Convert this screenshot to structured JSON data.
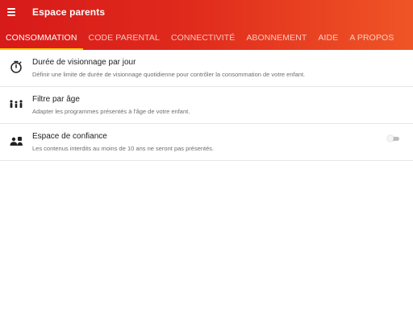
{
  "appbar": {
    "title": "Espace parents",
    "menu_icon": "hamburger-menu-icon",
    "gradient_start": "#d71a1a",
    "gradient_end": "#ef5526"
  },
  "tabs": [
    {
      "label": "CONSOMMATION",
      "active": true
    },
    {
      "label": "CODE PARENTAL",
      "active": false
    },
    {
      "label": "CONNECTIVITÉ",
      "active": false
    },
    {
      "label": "ABONNEMENT",
      "active": false
    },
    {
      "label": "AIDE",
      "active": false
    },
    {
      "label": "A PROPOS",
      "active": false
    }
  ],
  "tab_indicator_color": "#ffcc00",
  "settings": [
    {
      "icon": "timer-icon",
      "title": "Durée de visionnage par jour",
      "description": "Définir une limite de durée de visionnage quotidienne pour contrôler la consommation de votre enfant."
    },
    {
      "icon": "family-age-icon",
      "title": "Filtre par âge",
      "description": "Adapter les programmes présentés à l'âge de votre enfant."
    },
    {
      "icon": "trusted-space-icon",
      "title": "Espace de confiance",
      "description": "Les contenus interdits au moins de 10 ans ne seront pas présentés.",
      "toggle_on": false
    }
  ]
}
